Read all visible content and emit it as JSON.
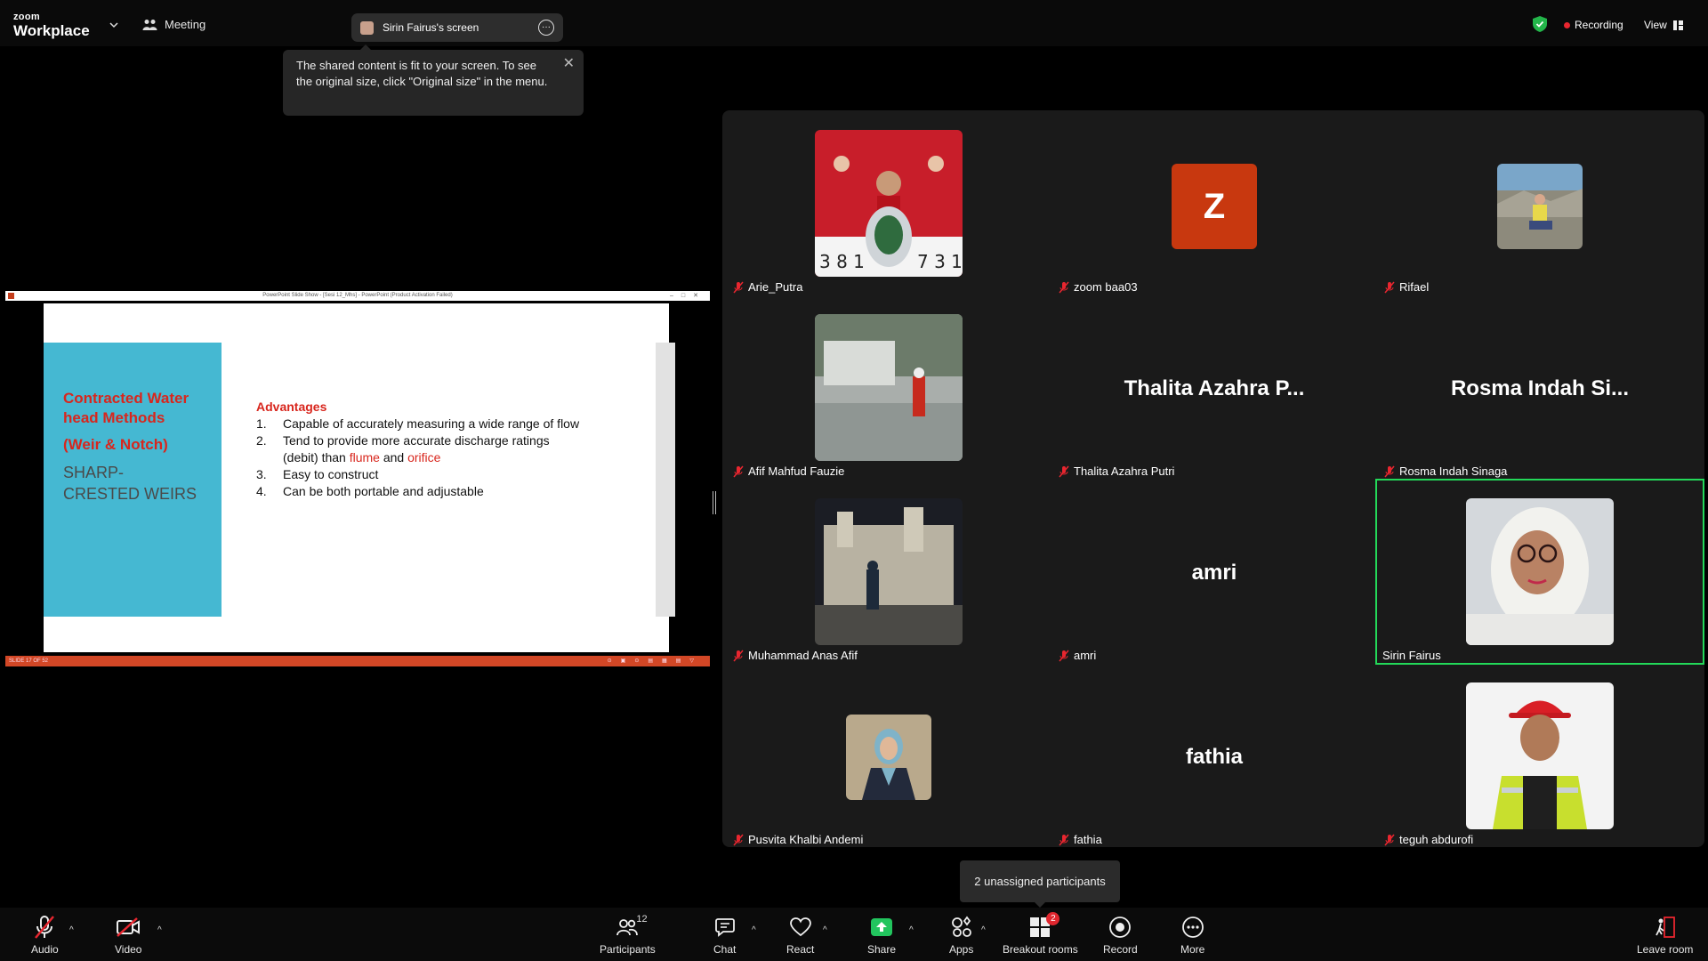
{
  "topbar": {
    "logo_small": "zoom",
    "logo_main": "Workplace",
    "meeting_label": "Meeting",
    "screen_label": "Sirin Fairus's screen",
    "recording_label": "Recording",
    "view_label": "View"
  },
  "tooltip": {
    "text": "The shared content is fit to your screen. To see the original size, click \"Original size\" in the menu."
  },
  "shared": {
    "window_title": "PowerPoint Slide Show - [Sesi 12_Mhs] - PowerPoint (Product Activation Failed)",
    "slide_status": "SLIDE 17 OF 52",
    "slide": {
      "title_line1": "Contracted Water",
      "title_line2": "head Methods",
      "title_line3": "(Weir & Notch)",
      "subtitle_line1": "SHARP-",
      "subtitle_line2": "CRESTED WEIRS",
      "advantages_heading": "Advantages",
      "items": [
        {
          "num": "1.",
          "text": "Capable of accurately measuring a wide range of flow"
        },
        {
          "num": "2.",
          "text_a": "Tend to provide more accurate discharge ratings",
          "text_b": "(debit) than ",
          "red1": "flume",
          "and": " and ",
          "red2": "orifice"
        },
        {
          "num": "3.",
          "text": "Easy to construct"
        },
        {
          "num": "4.",
          "text": "Can be both portable and adjustable"
        }
      ]
    }
  },
  "participants": [
    {
      "name": "Arie_Putra",
      "muted": true
    },
    {
      "name": "zoom baa03",
      "muted": true,
      "initial": "Z"
    },
    {
      "name": "Rifael",
      "muted": true
    },
    {
      "name": "Afif Mahfud Fauzie",
      "muted": true
    },
    {
      "name": "Thalita Azahra Putri",
      "muted": true,
      "display": "Thalita Azahra P..."
    },
    {
      "name": "Rosma Indah Sinaga",
      "muted": true,
      "display": "Rosma Indah Si..."
    },
    {
      "name": "Muhammad Anas Afif",
      "muted": true
    },
    {
      "name": "amri",
      "muted": true,
      "display": "amri"
    },
    {
      "name": "Sirin Fairus",
      "muted": false,
      "active_speaker": true
    },
    {
      "name": "Pusvita Khalbi Andemi",
      "muted": true
    },
    {
      "name": "fathia",
      "muted": true,
      "display": "fathia"
    },
    {
      "name": "teguh abdurofi",
      "muted": true
    }
  ],
  "unassigned": "2 unassigned participants",
  "toolbar": {
    "audio": "Audio",
    "video": "Video",
    "participants": "Participants",
    "participants_count": "12",
    "chat": "Chat",
    "react": "React",
    "share": "Share",
    "apps": "Apps",
    "breakout": "Breakout rooms",
    "breakout_badge": "2",
    "record": "Record",
    "more": "More",
    "leave": "Leave room"
  },
  "colors": {
    "accent_green": "#23d959",
    "slide_red": "#d8261d",
    "slide_teal": "#45b8d2",
    "zoom_tile_orange": "#c8380f",
    "share_green": "#22c55e"
  }
}
